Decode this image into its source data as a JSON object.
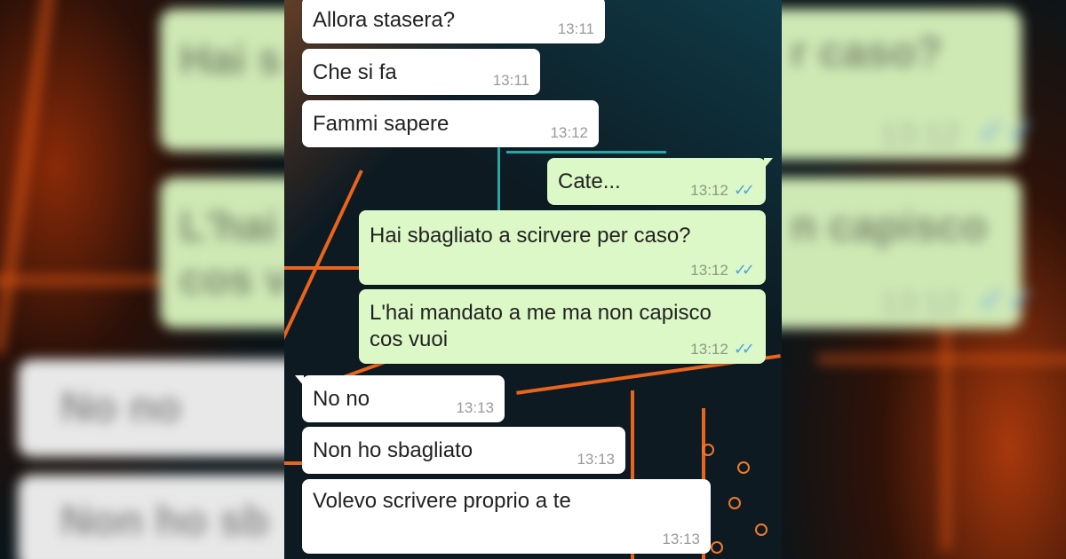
{
  "messages": [
    {
      "text": "Allora stasera?",
      "time": "13:11",
      "dir": "in"
    },
    {
      "text": "Che si fa",
      "time": "13:11",
      "dir": "in"
    },
    {
      "text": "Fammi sapere",
      "time": "13:12",
      "dir": "in"
    },
    {
      "text": "Cate...",
      "time": "13:12",
      "dir": "out"
    },
    {
      "text": "Hai sbagliato a scirvere per caso?",
      "time": "13:12",
      "dir": "out"
    },
    {
      "text": "L'hai mandato a me ma non capisco cos vuoi",
      "time": "13:12",
      "dir": "out"
    },
    {
      "text": "No no",
      "time": "13:13",
      "dir": "in"
    },
    {
      "text": "Non ho sbagliato",
      "time": "13:13",
      "dir": "in"
    },
    {
      "text": "Volevo scrivere proprio a te",
      "time": "13:13",
      "dir": "in"
    }
  ],
  "blurred": {
    "left": [
      "Hai s",
      "L'hai",
      "cos v",
      "No no",
      "Non ho sb"
    ],
    "right": [
      "r caso?",
      "13:12",
      "n capisco",
      "13:12"
    ]
  },
  "colors": {
    "incoming": "#ffffff",
    "outgoing": "#dcf8c6",
    "tick": "#4fa3e6",
    "accent": "#e9641d"
  },
  "icons": {
    "read_receipt": "double-check-icon"
  }
}
